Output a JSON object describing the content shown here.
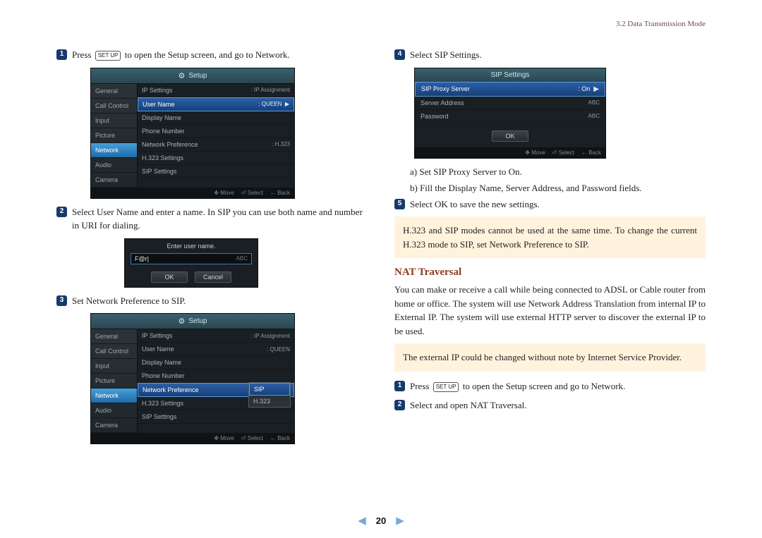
{
  "header": {
    "section": "3.2 Data Transmission Mode"
  },
  "left": {
    "step1_a": "Press",
    "step1_key": "SET UP",
    "step1_b": "to open the Setup screen, and go to Network.",
    "step2": "Select User Name and enter a name. In SIP you can use both name and number in URI for dialing.",
    "step3": "Set Network Preference to SIP.",
    "setup_title": "Setup",
    "side_items": [
      "General",
      "Call Control",
      "Input",
      "Picture",
      "Network",
      "Audio",
      "Camera"
    ],
    "main1": {
      "rows": [
        {
          "label": "IP Settings",
          "val": ": IP Assignment"
        },
        {
          "label": "User Name",
          "val": ": QUEEN",
          "sel": true,
          "arrow": true
        },
        {
          "label": "Display Name",
          "val": ""
        },
        {
          "label": "Phone Number",
          "val": ""
        },
        {
          "label": "Network Preference",
          "val": ": H.323"
        },
        {
          "label": "H.323 Settings",
          "val": ""
        },
        {
          "label": "SIP Settings",
          "val": ""
        }
      ]
    },
    "popup": {
      "title": "Enter user name.",
      "value": "F@r|",
      "hint": "ABC",
      "ok": "OK",
      "cancel": "Cancel"
    },
    "main2": {
      "rows": [
        {
          "label": "IP Settings",
          "val": ": IP Assignment"
        },
        {
          "label": "User Name",
          "val": ": QUEEN"
        },
        {
          "label": "Display Name",
          "val": ""
        },
        {
          "label": "Phone Number",
          "val": ""
        },
        {
          "label": "Network Preference",
          "val": "",
          "sel": true
        },
        {
          "label": "H.323 Settings",
          "val": ""
        },
        {
          "label": "SIP Settings",
          "val": ""
        }
      ],
      "dropdown": [
        "SIP",
        "H.323"
      ]
    },
    "footer": {
      "move": "Move",
      "select": "Select",
      "back": "Back"
    }
  },
  "right": {
    "step4": "Select SIP Settings.",
    "sip_title": "SIP Settings",
    "sip_rows": [
      {
        "label": "SIP Proxy Server",
        "val": ": On",
        "sel": true,
        "arrow": true
      },
      {
        "label": "Server Address",
        "val": "ABC"
      },
      {
        "label": "Password",
        "val": "ABC"
      }
    ],
    "sip_ok": "OK",
    "sub_a": "a)  Set SIP Proxy Server to On.",
    "sub_b": "b)  Fill the Display Name, Server Address, and Password fields.",
    "step5": "Select OK to save the new settings.",
    "note1": "H.323 and SIP modes cannot be used at the same time. To change the current H.323 mode to SIP, set Network Preference to SIP.",
    "nat_heading": "NAT Traversal",
    "nat_para": "You can make or receive a call while being connected to ADSL or Cable router from home or office. The system will use Network Address Translation from internal IP to External IP. The system will use external HTTP server to discover the external IP to be used.",
    "note2": "The external IP could be changed without note by Internet Service Provider.",
    "nstep1_a": "Press",
    "nstep1_key": "SET UP",
    "nstep1_b": "to open the Setup screen and go to Network.",
    "nstep2": "Select and open NAT Traversal."
  },
  "page": "20"
}
